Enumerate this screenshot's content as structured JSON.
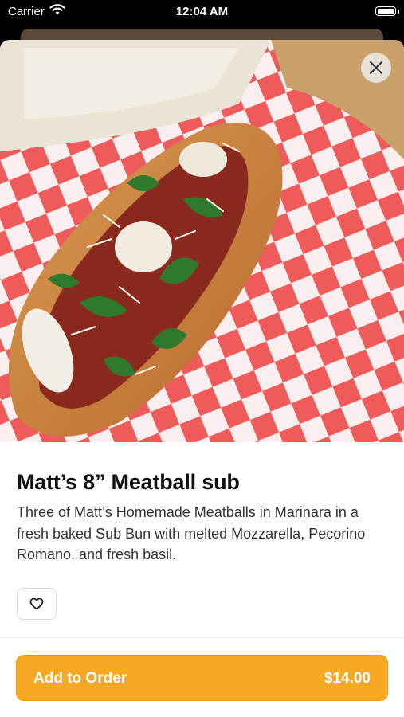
{
  "status_bar": {
    "carrier": "Carrier",
    "time": "12:04 AM"
  },
  "item": {
    "title": "Matt’s 8” Meatball sub",
    "description": "Three of Matt’s Homemade Meatballs in Marinara in a fresh baked Sub Bun with melted Mozzarella, Pecorino Romano, and fresh basil."
  },
  "actions": {
    "add_label": "Add to Order",
    "price": "$14.00"
  },
  "colors": {
    "accent": "#f6a823",
    "checker_red": "#ef5a5a"
  },
  "icons": {
    "close": "close-icon",
    "favorite": "heart-outline-icon",
    "wifi": "wifi-icon",
    "battery": "battery-icon"
  }
}
